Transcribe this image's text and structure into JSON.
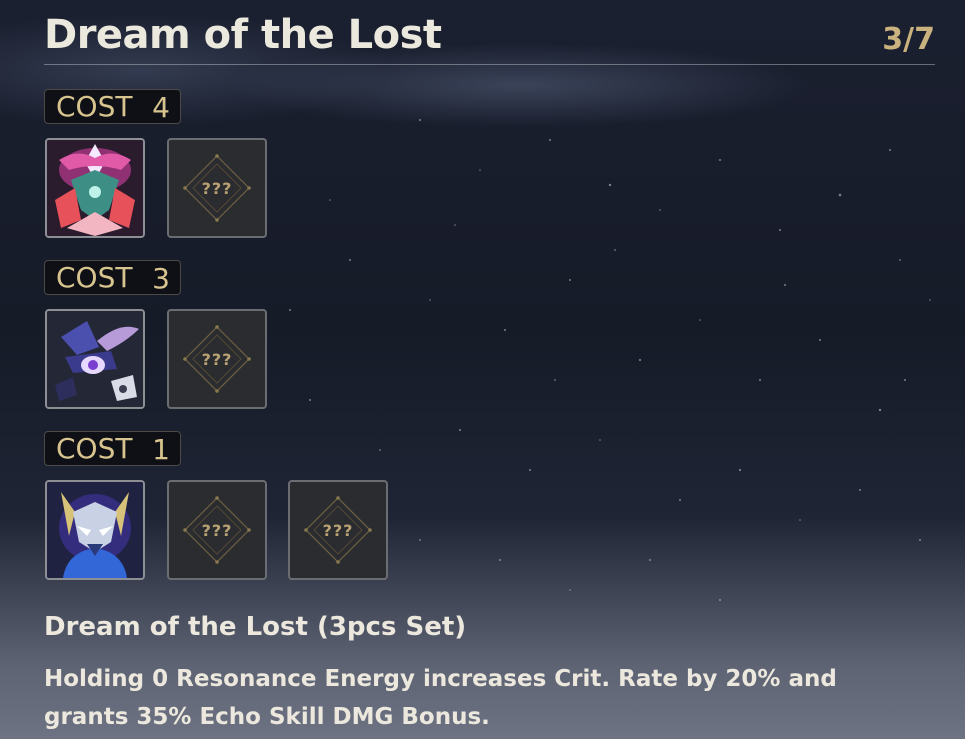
{
  "header": {
    "title": "Dream of the Lost",
    "progress": "3/7"
  },
  "groups": [
    {
      "cost_word": "COST",
      "cost_value": "4",
      "slots": [
        {
          "status": "unlocked",
          "icon": "echo-pink-armored-boss"
        },
        {
          "status": "unknown",
          "label": "???"
        }
      ]
    },
    {
      "cost_word": "COST",
      "cost_value": "3",
      "slots": [
        {
          "status": "unlocked",
          "icon": "echo-purple-eye-creature"
        },
        {
          "status": "unknown",
          "label": "???"
        }
      ]
    },
    {
      "cost_word": "COST",
      "cost_value": "1",
      "slots": [
        {
          "status": "unlocked",
          "icon": "echo-blue-gold-helm"
        },
        {
          "status": "unknown",
          "label": "???"
        },
        {
          "status": "unknown",
          "label": "???"
        }
      ]
    }
  ],
  "set_bonus": {
    "title": "Dream of the Lost (3pcs Set)",
    "description": "Holding 0 Resonance Energy increases Crit. Rate by 20% and grants 35% Echo Skill DMG Bonus."
  },
  "colors": {
    "accent_gold": "#c9b27d",
    "badge_bg": "#0e1016",
    "text": "#ece8de"
  }
}
